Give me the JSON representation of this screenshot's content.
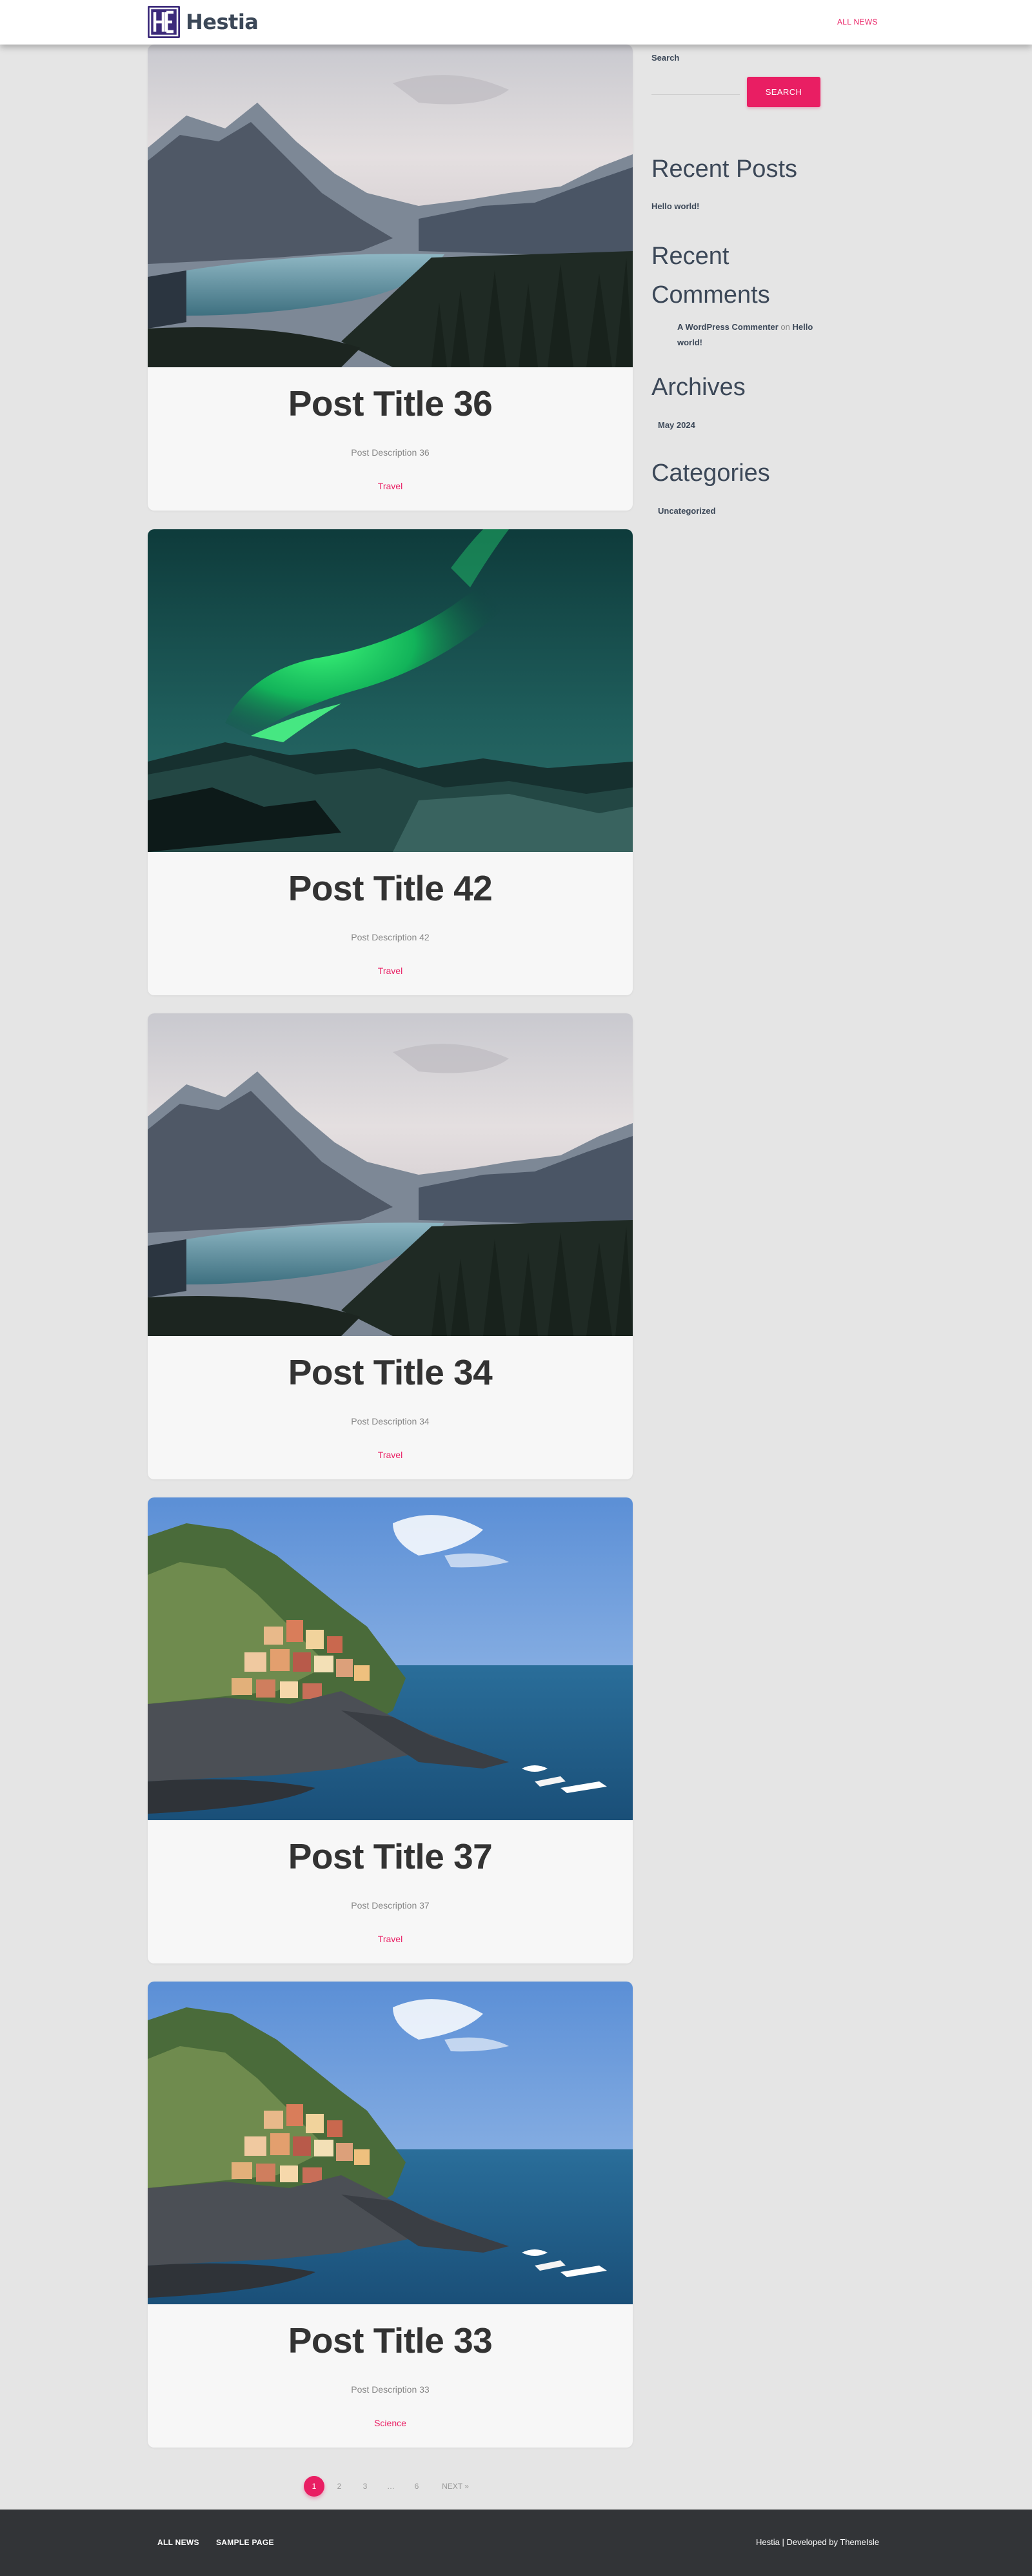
{
  "header": {
    "logo_text": "Hestia",
    "nav": [
      {
        "label": "ALL NEWS"
      }
    ]
  },
  "posts": [
    {
      "title": "Post Title 36",
      "description": "Post Description 36",
      "category": "Travel",
      "image": "lake-mountains"
    },
    {
      "title": "Post Title 42",
      "description": "Post Description 42",
      "category": "Travel",
      "image": "aurora"
    },
    {
      "title": "Post Title 34",
      "description": "Post Description 34",
      "category": "Travel",
      "image": "lake-mountains"
    },
    {
      "title": "Post Title 37",
      "description": "Post Description 37",
      "category": "Travel",
      "image": "coastal-village"
    },
    {
      "title": "Post Title 33",
      "description": "Post Description 33",
      "category": "Science",
      "image": "coastal-village"
    }
  ],
  "sidebar": {
    "search": {
      "label": "Search",
      "placeholder": "",
      "value": "",
      "button_label": "SEARCH"
    },
    "recent_posts": {
      "title": "Recent Posts",
      "items": [
        "Hello world!"
      ]
    },
    "recent_comments": {
      "title_line1": "Recent",
      "title_line2": "Comments",
      "items": [
        {
          "author": "A WordPress Commenter",
          "connector": "on",
          "post": "Hello world!"
        }
      ]
    },
    "archives": {
      "title": "Archives",
      "items": [
        "May 2024"
      ]
    },
    "categories": {
      "title": "Categories",
      "items": [
        "Uncategorized"
      ]
    }
  },
  "pagination": {
    "pages": [
      "1",
      "2",
      "3",
      "…",
      "6"
    ],
    "current": "1",
    "next_label": "NEXT »"
  },
  "footer": {
    "links": [
      "ALL NEWS",
      "SAMPLE PAGE"
    ],
    "credit": "Hestia | Developed by ThemeIsle"
  },
  "colors": {
    "accent": "#e91e63",
    "footer_bg": "#323437",
    "page_bg": "#e5e5e5",
    "card_bg": "#f7f7f7"
  }
}
